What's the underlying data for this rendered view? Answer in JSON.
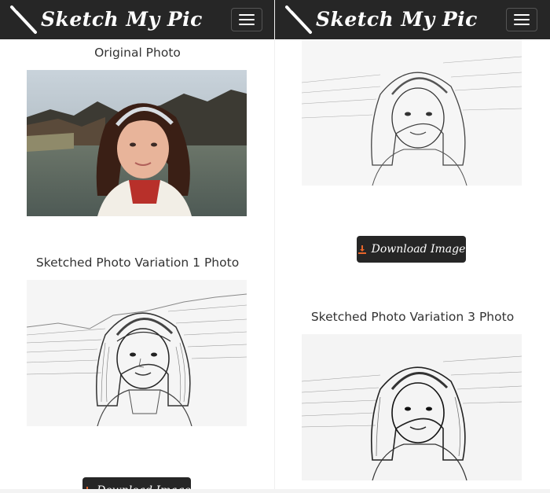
{
  "app": {
    "brand": "Sketch My Pic",
    "menu_icon": "hamburger-icon"
  },
  "left": {
    "original_caption": "Original Photo",
    "variation1_caption": "Sketched Photo Variation 1 Photo",
    "download_label": "Download Image"
  },
  "right": {
    "download_label": "Download Image",
    "variation3_caption": "Sketched Photo Variation 3 Photo"
  },
  "colors": {
    "navbar": "#262626",
    "button": "#262626",
    "download_icon": "#e8652a"
  }
}
